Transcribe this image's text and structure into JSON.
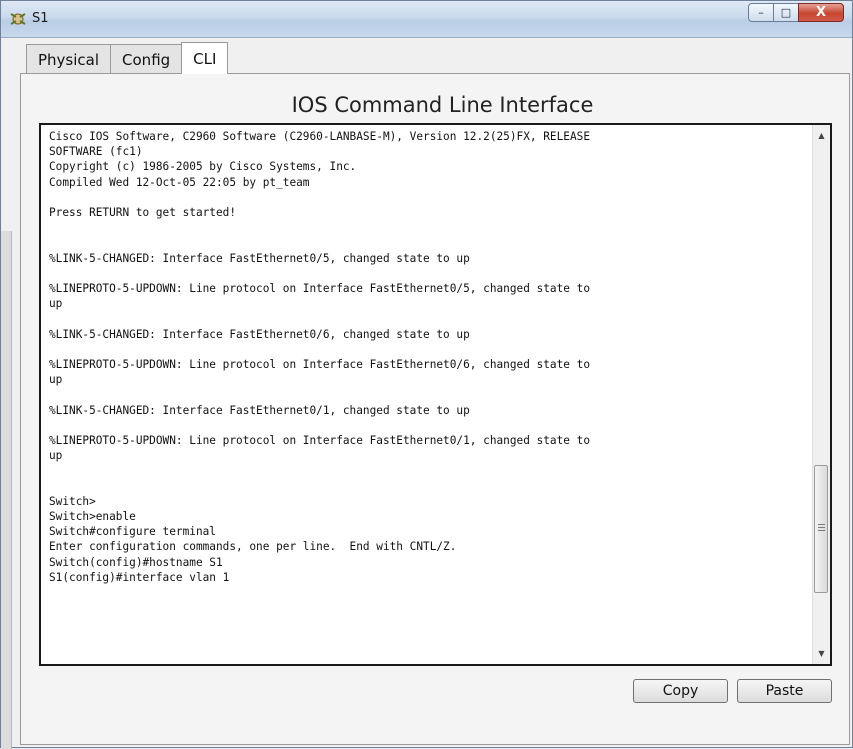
{
  "window": {
    "title": "S1",
    "controls": {
      "minimize": "–",
      "maximize": "□",
      "close": "X"
    }
  },
  "tabs": [
    {
      "label": "Physical",
      "active": false
    },
    {
      "label": "Config",
      "active": false
    },
    {
      "label": "CLI",
      "active": true
    }
  ],
  "cli": {
    "heading": "IOS Command Line Interface",
    "output": [
      "Cisco IOS Software, C2960 Software (C2960-LANBASE-M), Version 12.2(25)FX, RELEASE",
      "SOFTWARE (fc1)",
      "Copyright (c) 1986-2005 by Cisco Systems, Inc.",
      "Compiled Wed 12-Oct-05 22:05 by pt_team",
      "",
      "Press RETURN to get started!",
      "",
      "",
      "%LINK-5-CHANGED: Interface FastEthernet0/5, changed state to up",
      "",
      "%LINEPROTO-5-UPDOWN: Line protocol on Interface FastEthernet0/5, changed state to",
      "up",
      "",
      "%LINK-5-CHANGED: Interface FastEthernet0/6, changed state to up",
      "",
      "%LINEPROTO-5-UPDOWN: Line protocol on Interface FastEthernet0/6, changed state to",
      "up",
      "",
      "%LINK-5-CHANGED: Interface FastEthernet0/1, changed state to up",
      "",
      "%LINEPROTO-5-UPDOWN: Line protocol on Interface FastEthernet0/1, changed state to",
      "up",
      "",
      "",
      "Switch>",
      "Switch>enable",
      "Switch#configure terminal",
      "Enter configuration commands, one per line.  End with CNTL/Z.",
      "Switch(config)#hostname S1",
      "S1(config)#interface vlan 1"
    ]
  },
  "buttons": {
    "copy": "Copy",
    "paste": "Paste"
  },
  "icons": {
    "app": "packet-tracer-device-icon",
    "scroll_up": "chevron-up-icon",
    "scroll_down": "chevron-down-icon"
  }
}
